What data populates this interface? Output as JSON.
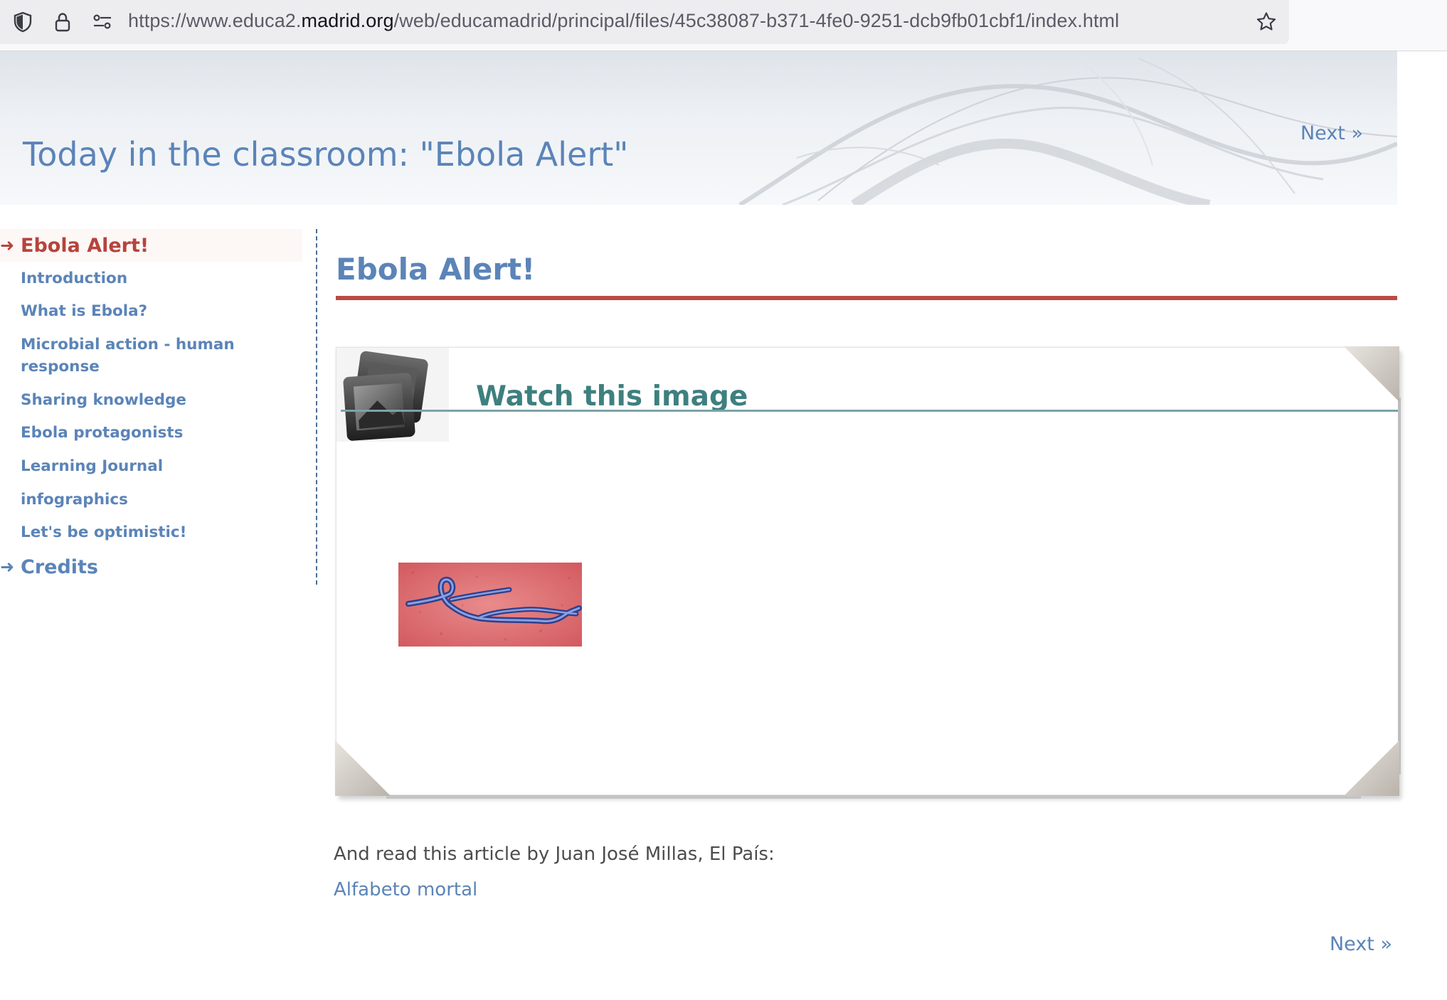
{
  "browser": {
    "url_prefix": "https://www.educa2.",
    "url_host": "madrid.org",
    "url_path": "/web/educamadrid/principal/files/45c38087-b371-4fe0-9251-dcb9fb01cbf1/index.html",
    "icons": [
      "shield-icon",
      "lock-icon",
      "site-permissions-icon",
      "bookmark-star-icon"
    ]
  },
  "banner": {
    "title": "Today in the classroom: \"Ebola Alert\"",
    "next_label": "Next »"
  },
  "sidebar": {
    "items": [
      {
        "label": "Ebola Alert!",
        "level": "top",
        "active": true,
        "arrow": "➜"
      },
      {
        "label": "Introduction",
        "level": "sub"
      },
      {
        "label": "What is Ebola?",
        "level": "sub"
      },
      {
        "label": "Microbial action - human response",
        "level": "sub"
      },
      {
        "label": "Sharing knowledge",
        "level": "sub"
      },
      {
        "label": "Ebola protagonists",
        "level": "sub"
      },
      {
        "label": "Learning Journal",
        "level": "sub"
      },
      {
        "label": "infographics",
        "level": "sub"
      },
      {
        "label": "Let's be optimistic!",
        "level": "sub"
      },
      {
        "label": "Credits",
        "level": "top",
        "arrow": "➜"
      }
    ]
  },
  "main": {
    "title": "Ebola Alert!",
    "panel": {
      "heading": "Watch this image",
      "icon": "image-frame-icon",
      "image": "ebola-virus-micrograph"
    },
    "article_text": "And read this article by Juan José Millas, El País:",
    "article_link": "Alfabeto mortal",
    "next_label": "Next »"
  },
  "colors": {
    "link_blue": "#5b84b8",
    "active_red": "#b5443c",
    "rule_red": "#b94b45",
    "panel_teal": "#3e807f"
  }
}
